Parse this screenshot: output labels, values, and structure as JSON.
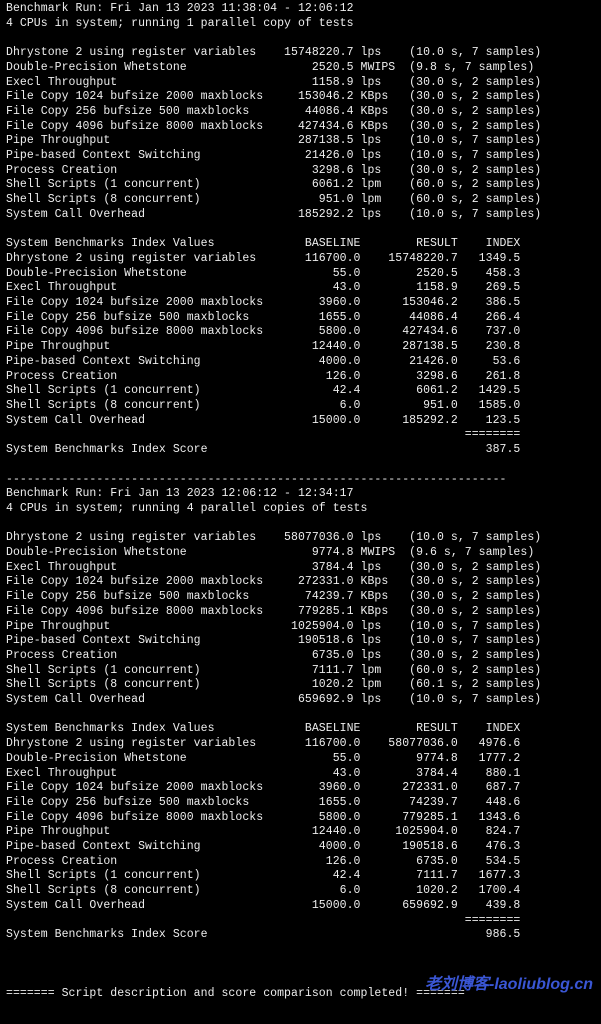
{
  "run1": {
    "header": "Benchmark Run: Fri Jan 13 2023 11:38:04 - 12:06:12",
    "cpus": "4 CPUs in system; running 1 parallel copy of tests",
    "tests": [
      {
        "name": "Dhrystone 2 using register variables",
        "value": "15748220.7",
        "unit": "lps",
        "time": "10.0",
        "samples": "7"
      },
      {
        "name": "Double-Precision Whetstone",
        "value": "2520.5",
        "unit": "MWIPS",
        "time": "9.8",
        "samples": "7"
      },
      {
        "name": "Execl Throughput",
        "value": "1158.9",
        "unit": "lps",
        "time": "30.0",
        "samples": "2"
      },
      {
        "name": "File Copy 1024 bufsize 2000 maxblocks",
        "value": "153046.2",
        "unit": "KBps",
        "time": "30.0",
        "samples": "2"
      },
      {
        "name": "File Copy 256 bufsize 500 maxblocks",
        "value": "44086.4",
        "unit": "KBps",
        "time": "30.0",
        "samples": "2"
      },
      {
        "name": "File Copy 4096 bufsize 8000 maxblocks",
        "value": "427434.6",
        "unit": "KBps",
        "time": "30.0",
        "samples": "2"
      },
      {
        "name": "Pipe Throughput",
        "value": "287138.5",
        "unit": "lps",
        "time": "10.0",
        "samples": "7"
      },
      {
        "name": "Pipe-based Context Switching",
        "value": "21426.0",
        "unit": "lps",
        "time": "10.0",
        "samples": "7"
      },
      {
        "name": "Process Creation",
        "value": "3298.6",
        "unit": "lps",
        "time": "30.0",
        "samples": "2"
      },
      {
        "name": "Shell Scripts (1 concurrent)",
        "value": "6061.2",
        "unit": "lpm",
        "time": "60.0",
        "samples": "2"
      },
      {
        "name": "Shell Scripts (8 concurrent)",
        "value": "951.0",
        "unit": "lpm",
        "time": "60.0",
        "samples": "2"
      },
      {
        "name": "System Call Overhead",
        "value": "185292.2",
        "unit": "lps",
        "time": "10.0",
        "samples": "7"
      }
    ],
    "indexHeader": {
      "name": "System Benchmarks Index Values",
      "col1": "BASELINE",
      "col2": "RESULT",
      "col3": "INDEX"
    },
    "index": [
      {
        "name": "Dhrystone 2 using register variables",
        "baseline": "116700.0",
        "result": "15748220.7",
        "index": "1349.5"
      },
      {
        "name": "Double-Precision Whetstone",
        "baseline": "55.0",
        "result": "2520.5",
        "index": "458.3"
      },
      {
        "name": "Execl Throughput",
        "baseline": "43.0",
        "result": "1158.9",
        "index": "269.5"
      },
      {
        "name": "File Copy 1024 bufsize 2000 maxblocks",
        "baseline": "3960.0",
        "result": "153046.2",
        "index": "386.5"
      },
      {
        "name": "File Copy 256 bufsize 500 maxblocks",
        "baseline": "1655.0",
        "result": "44086.4",
        "index": "266.4"
      },
      {
        "name": "File Copy 4096 bufsize 8000 maxblocks",
        "baseline": "5800.0",
        "result": "427434.6",
        "index": "737.0"
      },
      {
        "name": "Pipe Throughput",
        "baseline": "12440.0",
        "result": "287138.5",
        "index": "230.8"
      },
      {
        "name": "Pipe-based Context Switching",
        "baseline": "4000.0",
        "result": "21426.0",
        "index": "53.6"
      },
      {
        "name": "Process Creation",
        "baseline": "126.0",
        "result": "3298.6",
        "index": "261.8"
      },
      {
        "name": "Shell Scripts (1 concurrent)",
        "baseline": "42.4",
        "result": "6061.2",
        "index": "1429.5"
      },
      {
        "name": "Shell Scripts (8 concurrent)",
        "baseline": "6.0",
        "result": "951.0",
        "index": "1585.0"
      },
      {
        "name": "System Call Overhead",
        "baseline": "15000.0",
        "result": "185292.2",
        "index": "123.5"
      }
    ],
    "scoreLabel": "System Benchmarks Index Score",
    "score": "387.5"
  },
  "run2": {
    "header": "Benchmark Run: Fri Jan 13 2023 12:06:12 - 12:34:17",
    "cpus": "4 CPUs in system; running 4 parallel copies of tests",
    "tests": [
      {
        "name": "Dhrystone 2 using register variables",
        "value": "58077036.0",
        "unit": "lps",
        "time": "10.0",
        "samples": "7"
      },
      {
        "name": "Double-Precision Whetstone",
        "value": "9774.8",
        "unit": "MWIPS",
        "time": "9.6",
        "samples": "7"
      },
      {
        "name": "Execl Throughput",
        "value": "3784.4",
        "unit": "lps",
        "time": "30.0",
        "samples": "2"
      },
      {
        "name": "File Copy 1024 bufsize 2000 maxblocks",
        "value": "272331.0",
        "unit": "KBps",
        "time": "30.0",
        "samples": "2"
      },
      {
        "name": "File Copy 256 bufsize 500 maxblocks",
        "value": "74239.7",
        "unit": "KBps",
        "time": "30.0",
        "samples": "2"
      },
      {
        "name": "File Copy 4096 bufsize 8000 maxblocks",
        "value": "779285.1",
        "unit": "KBps",
        "time": "30.0",
        "samples": "2"
      },
      {
        "name": "Pipe Throughput",
        "value": "1025904.0",
        "unit": "lps",
        "time": "10.0",
        "samples": "7"
      },
      {
        "name": "Pipe-based Context Switching",
        "value": "190518.6",
        "unit": "lps",
        "time": "10.0",
        "samples": "7"
      },
      {
        "name": "Process Creation",
        "value": "6735.0",
        "unit": "lps",
        "time": "30.0",
        "samples": "2"
      },
      {
        "name": "Shell Scripts (1 concurrent)",
        "value": "7111.7",
        "unit": "lpm",
        "time": "60.0",
        "samples": "2"
      },
      {
        "name": "Shell Scripts (8 concurrent)",
        "value": "1020.2",
        "unit": "lpm",
        "time": "60.1",
        "samples": "2"
      },
      {
        "name": "System Call Overhead",
        "value": "659692.9",
        "unit": "lps",
        "time": "10.0",
        "samples": "7"
      }
    ],
    "indexHeader": {
      "name": "System Benchmarks Index Values",
      "col1": "BASELINE",
      "col2": "RESULT",
      "col3": "INDEX"
    },
    "index": [
      {
        "name": "Dhrystone 2 using register variables",
        "baseline": "116700.0",
        "result": "58077036.0",
        "index": "4976.6"
      },
      {
        "name": "Double-Precision Whetstone",
        "baseline": "55.0",
        "result": "9774.8",
        "index": "1777.2"
      },
      {
        "name": "Execl Throughput",
        "baseline": "43.0",
        "result": "3784.4",
        "index": "880.1"
      },
      {
        "name": "File Copy 1024 bufsize 2000 maxblocks",
        "baseline": "3960.0",
        "result": "272331.0",
        "index": "687.7"
      },
      {
        "name": "File Copy 256 bufsize 500 maxblocks",
        "baseline": "1655.0",
        "result": "74239.7",
        "index": "448.6"
      },
      {
        "name": "File Copy 4096 bufsize 8000 maxblocks",
        "baseline": "5800.0",
        "result": "779285.1",
        "index": "1343.6"
      },
      {
        "name": "Pipe Throughput",
        "baseline": "12440.0",
        "result": "1025904.0",
        "index": "824.7"
      },
      {
        "name": "Pipe-based Context Switching",
        "baseline": "4000.0",
        "result": "190518.6",
        "index": "476.3"
      },
      {
        "name": "Process Creation",
        "baseline": "126.0",
        "result": "6735.0",
        "index": "534.5"
      },
      {
        "name": "Shell Scripts (1 concurrent)",
        "baseline": "42.4",
        "result": "7111.7",
        "index": "1677.3"
      },
      {
        "name": "Shell Scripts (8 concurrent)",
        "baseline": "6.0",
        "result": "1020.2",
        "index": "1700.4"
      },
      {
        "name": "System Call Overhead",
        "baseline": "15000.0",
        "result": "659692.9",
        "index": "439.8"
      }
    ],
    "scoreLabel": "System Benchmarks Index Score",
    "score": "986.5"
  },
  "divider": "------------------------------------------------------------------------",
  "eqline": "========",
  "footer": "======= Script description and score comparison completed! =======",
  "watermark": "老刘博客-laoliublog.cn"
}
